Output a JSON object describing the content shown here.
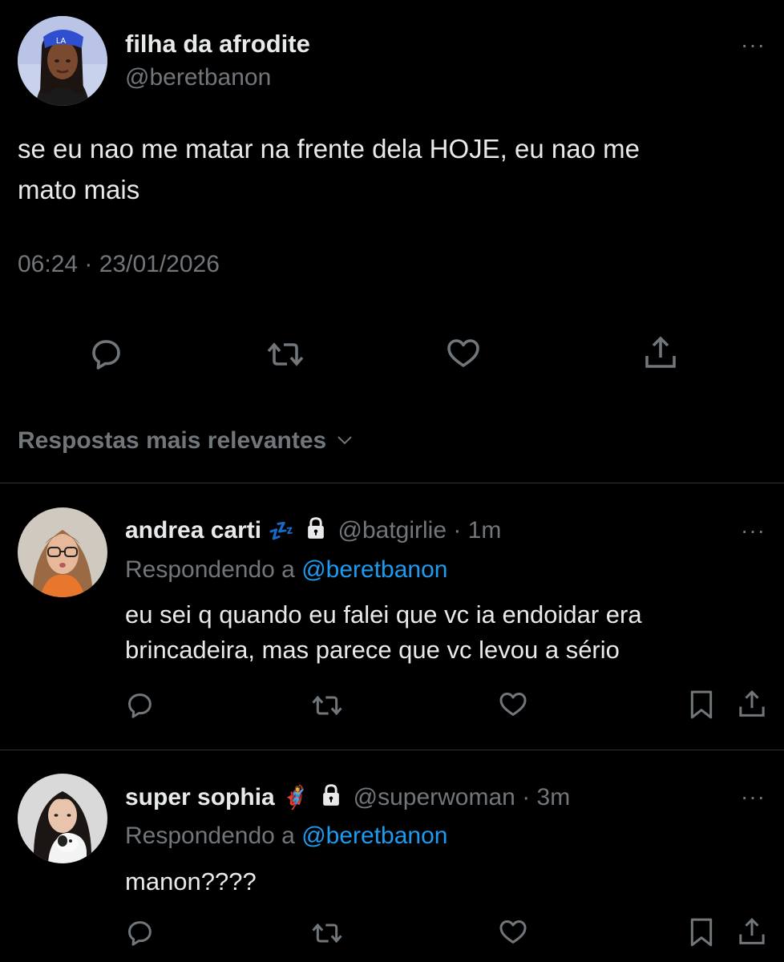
{
  "main_tweet": {
    "display_name": "filha da afrodite",
    "handle": "@beretbanon",
    "text_line1": "se eu nao me matar na frente dela HOJE, eu nao me",
    "text_line2": "mato mais",
    "timestamp": "06:24 · 23/01/2026"
  },
  "sort": {
    "label": "Respostas mais relevantes"
  },
  "replies": [
    {
      "display_name": "andrea carti",
      "emoji": "💤",
      "handle": "@batgirlie",
      "time": "· 1m",
      "replying_prefix": "Respondendo a",
      "replying_to": "@beretbanon",
      "text_line1": "eu sei q quando eu falei que vc ia endoidar era",
      "text_line2": "brincadeira, mas parece que vc levou a sério"
    },
    {
      "display_name": "super sophia",
      "emoji": "🦸‍♀️",
      "handle": "@superwoman",
      "time": "· 3m",
      "replying_prefix": "Respondendo a",
      "replying_to": "@beretbanon",
      "text_line1": "manon????"
    }
  ],
  "more_glyph": "···",
  "colors": {
    "background": "#000000",
    "text": "#e7e9ea",
    "muted": "#71767b",
    "link": "#1d9bf0",
    "divider": "#2f3336"
  }
}
